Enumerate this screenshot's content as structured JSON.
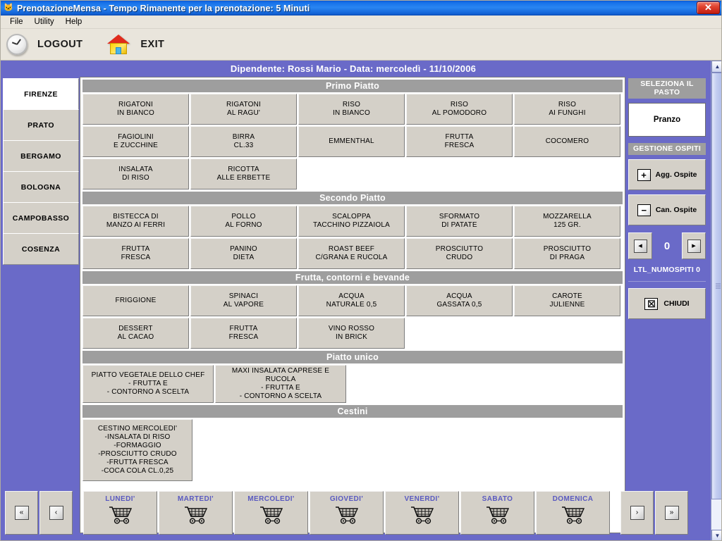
{
  "window": {
    "title": "PrenotazioneMensa - Tempo Rimanente per la prenotazione: 5 Minuti",
    "app_icon": "app-icon",
    "close_label": "✕"
  },
  "menubar": {
    "items": [
      {
        "label": "File"
      },
      {
        "label": "Utility"
      },
      {
        "label": "Help"
      }
    ]
  },
  "toolbar": {
    "buttons": [
      {
        "label": "LOGOUT",
        "icon": "clock-icon"
      },
      {
        "label": "EXIT",
        "icon": "house-icon"
      }
    ]
  },
  "header": {
    "text": "Dipendente: Rossi Mario - Data: mercoledì - 11/10/2006"
  },
  "cities": {
    "items": [
      {
        "label": "FIRENZE",
        "selected": true
      },
      {
        "label": "PRATO",
        "selected": false
      },
      {
        "label": "BERGAMO",
        "selected": false
      },
      {
        "label": "BOLOGNA",
        "selected": false
      },
      {
        "label": "CAMPOBASSO",
        "selected": false
      },
      {
        "label": "COSENZA",
        "selected": false
      }
    ]
  },
  "menu_sections": [
    {
      "title": "Primo Piatto",
      "dishes": [
        {
          "line1": "RIGATONI",
          "line2": "IN BIANCO"
        },
        {
          "line1": "RIGATONI",
          "line2": "AL RAGU'"
        },
        {
          "line1": "RISO",
          "line2": "IN BIANCO"
        },
        {
          "line1": "RISO",
          "line2": "AL POMODORO"
        },
        {
          "line1": "RISO",
          "line2": "AI FUNGHI"
        },
        {
          "line1": "FAGIOLINI",
          "line2": "E ZUCCHINE"
        },
        {
          "line1": "BIRRA",
          "line2": "CL.33"
        },
        {
          "line1": "EMMENTHAL",
          "line2": ""
        },
        {
          "line1": "FRUTTA",
          "line2": "FRESCA"
        },
        {
          "line1": "COCOMERO",
          "line2": ""
        },
        {
          "line1": "INSALATA",
          "line2": "DI RISO"
        },
        {
          "line1": "RICOTTA",
          "line2": "ALLE ERBETTE"
        }
      ]
    },
    {
      "title": "Secondo Piatto",
      "dishes": [
        {
          "line1": "BISTECCA DI",
          "line2": "MANZO AI FERRI"
        },
        {
          "line1": "POLLO",
          "line2": "AL FORNO"
        },
        {
          "line1": "SCALOPPA",
          "line2": "TACCHINO PIZZAIOLA"
        },
        {
          "line1": "SFORMATO",
          "line2": "DI PATATE"
        },
        {
          "line1": "MOZZARELLA",
          "line2": "125 GR."
        },
        {
          "line1": "FRUTTA",
          "line2": "FRESCA"
        },
        {
          "line1": "PANINO",
          "line2": "DIETA"
        },
        {
          "line1": "ROAST BEEF",
          "line2": "C/GRANA E RUCOLA"
        },
        {
          "line1": "PROSCIUTTO",
          "line2": "CRUDO"
        },
        {
          "line1": "PROSCIUTTO",
          "line2": "DI PRAGA"
        }
      ]
    },
    {
      "title": "Frutta, contorni e bevande",
      "dishes": [
        {
          "line1": "FRIGGIONE",
          "line2": ""
        },
        {
          "line1": "SPINACI",
          "line2": "AL VAPORE"
        },
        {
          "line1": "ACQUA",
          "line2": "NATURALE 0,5"
        },
        {
          "line1": "ACQUA",
          "line2": "GASSATA 0,5"
        },
        {
          "line1": "CAROTE",
          "line2": "JULIENNE"
        },
        {
          "line1": "DESSERT",
          "line2": "AL CACAO"
        },
        {
          "line1": "FRUTTA",
          "line2": "FRESCA"
        },
        {
          "line1": "VINO ROSSO",
          "line2": "IN BRICK"
        }
      ]
    },
    {
      "title": "Piatto unico",
      "dishes": [
        {
          "line1": "PIATTO VEGETALE DELLO CHEF",
          "line2": "- FRUTTA E",
          "line3": "- CONTORNO A SCELTA"
        },
        {
          "line1": "MAXI INSALATA CAPRESE E RUCOLA",
          "line2": "- FRUTTA E",
          "line3": "- CONTORNO A SCELTA"
        }
      ]
    },
    {
      "title": "Cestini",
      "dishes": [
        {
          "line1": "CESTINO MERCOLEDI'",
          "line2": "-INSALATA DI RISO",
          "line3": "-FORMAGGIO",
          "line4": "-PROSCIUTTO CRUDO",
          "line5": "-FRUTTA FRESCA",
          "line6": "-COCA COLA CL.0,25"
        }
      ]
    }
  ],
  "right_panel": {
    "meal_header_line1": "SELEZIONA IL",
    "meal_header_line2": "PASTO",
    "meal_value": "Pranzo",
    "guests_header": "GESTIONE OSPITI",
    "add_guest_label": "Agg. Ospite",
    "add_guest_icon": "plus-icon",
    "add_guest_glyph": "+",
    "del_guest_label": "Can. Ospite",
    "del_guest_icon": "minus-icon",
    "del_guest_glyph": "−",
    "prev_glyph": "◂",
    "next_glyph": "▸",
    "guest_count": "0",
    "guest_note": "LTL_NUMOSPITI 0",
    "close_label": "CHIUDI",
    "close_icon": "close-x-icon",
    "close_glyph": "☒"
  },
  "daybar": {
    "first_glyph": "«",
    "prev_glyph": "‹",
    "next_glyph": "›",
    "last_glyph": "»",
    "days": [
      {
        "label": "LUNEDI'"
      },
      {
        "label": "MARTEDI'"
      },
      {
        "label": "MERCOLEDI'"
      },
      {
        "label": "GIOVEDI'"
      },
      {
        "label": "VENERDI'"
      },
      {
        "label": "SABATO"
      },
      {
        "label": "DOMENICA"
      }
    ]
  },
  "scrollbar": {
    "up_glyph": "▲",
    "down_glyph": "▼"
  },
  "colors": {
    "desktop": "#6a6ac8",
    "chrome": "#d4d0c8",
    "section_header": "#9e9e9e",
    "accent_title": "#1670e8",
    "day_label": "#5a5ac0"
  }
}
